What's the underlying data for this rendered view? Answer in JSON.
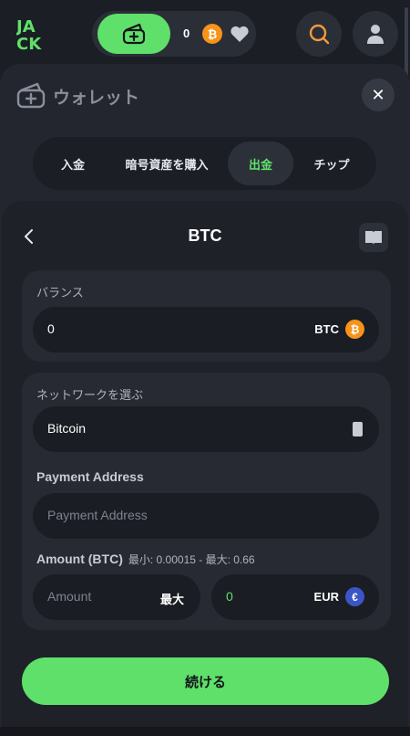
{
  "header": {
    "logo_text": "JACK",
    "balance_value": "0",
    "currency_icon": "bitcoin-icon",
    "colors": {
      "accent": "#5fe06a",
      "bitcoin": "#f7931a",
      "background": "#1b1e25"
    }
  },
  "modal": {
    "title": "ウォレット",
    "tabs": [
      {
        "label": "入金",
        "active": false
      },
      {
        "label": "暗号資産を購入",
        "active": false
      },
      {
        "label": "出金",
        "active": true
      },
      {
        "label": "チップ",
        "active": false
      }
    ]
  },
  "withdraw": {
    "title": "BTC",
    "balance_label": "バランス",
    "balance_value": "0",
    "balance_currency": "BTC",
    "network_label": "ネットワークを選ぶ",
    "network_value": "Bitcoin",
    "address_label": "Payment Address",
    "address_placeholder": "Payment Address",
    "amount_label": "Amount (BTC)",
    "amount_limits": "最小: 0.00015 - 最大: 0.66",
    "amount_placeholder": "Amount",
    "max_label": "最大",
    "fiat_value": "0",
    "fiat_currency": "EUR",
    "continue_label": "続ける"
  }
}
